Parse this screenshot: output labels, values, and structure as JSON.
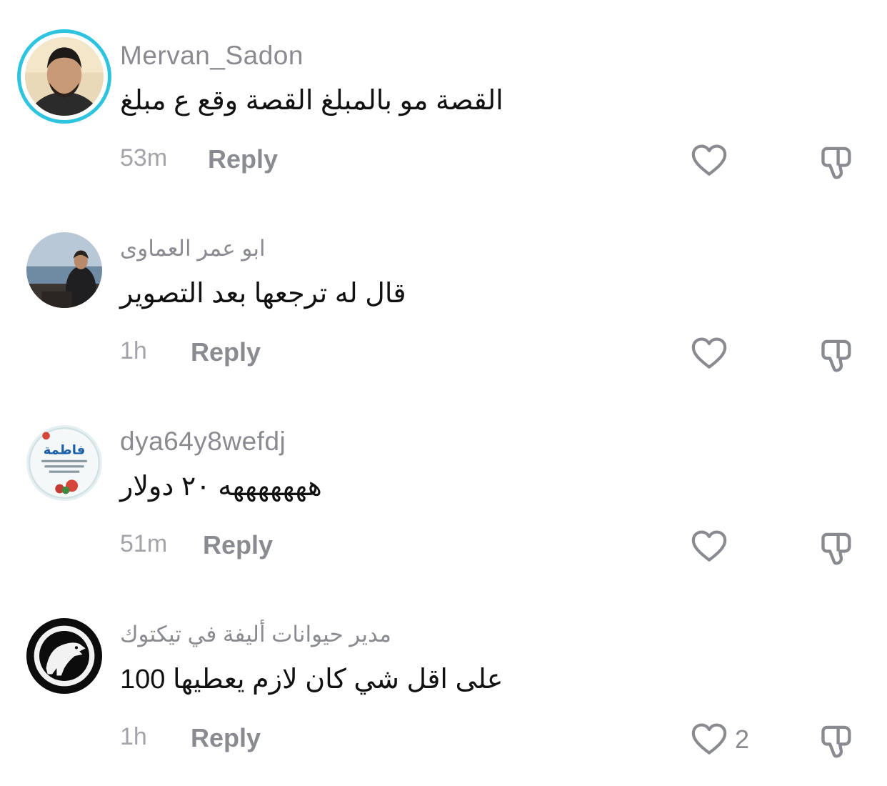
{
  "comments": [
    {
      "username": "Mervan_Sadon",
      "text": "القصة مو بالمبلغ القصة وقع ع مبلغ",
      "time": "53m",
      "reply_label": "Reply",
      "like_count": "",
      "avatar_icon": "profile-photo-man"
    },
    {
      "username": "ابو  عمر العماوى",
      "text": "قال له ترجعها بعد التصوير",
      "time": "1h",
      "reply_label": "Reply",
      "like_count": "",
      "avatar_icon": "profile-photo-sea"
    },
    {
      "username": "dya64y8wefdj",
      "text": "هههههههه ٢٠ دولار",
      "time": "51m",
      "reply_label": "Reply",
      "like_count": "",
      "avatar_icon": "profile-image-fatima-card",
      "avatar_text": "فاطمة"
    },
    {
      "username": "مدير حيوانات أليفة في تيكتوك",
      "text": "على اقل شي كان لازم يعطيها 100",
      "time": "1h",
      "reply_label": "Reply",
      "like_count": "2",
      "avatar_icon": "dinosaur-logo"
    }
  ],
  "colors": {
    "story_ring": "#2ec4e0",
    "secondary_text": "#8a8b91",
    "primary_text": "#111111"
  }
}
